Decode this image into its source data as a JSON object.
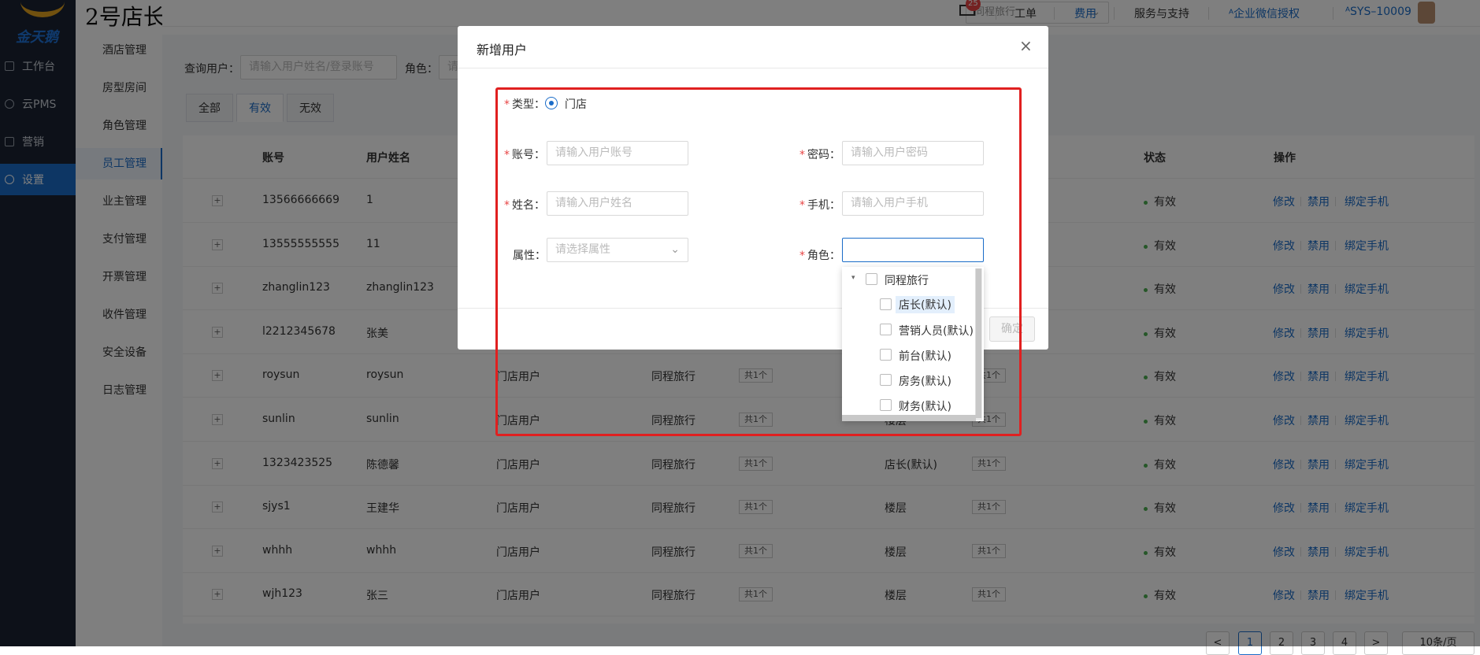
{
  "brand": {
    "logo_text": "金天鹅",
    "shop_title": "2号店长"
  },
  "rail": [
    {
      "label": "工作台",
      "icon": "grid-icon"
    },
    {
      "label": "云PMS",
      "icon": "settings-icon"
    },
    {
      "label": "营销",
      "icon": "grid-icon"
    },
    {
      "label": "设置",
      "icon": "gear-icon",
      "active": true
    }
  ],
  "submenu": [
    "酒店管理",
    "房型房间",
    "角色管理",
    "员工管理",
    "业主管理",
    "支付管理",
    "开票管理",
    "收件管理",
    "安全设备",
    "日志管理"
  ],
  "topbar": {
    "store_select": "同程旅行",
    "mail_badge": "25",
    "links": {
      "ticket": "工单",
      "fee": "费用",
      "service": "服务与支持",
      "wechat": "企业微信授权",
      "user": "SYS–10009"
    }
  },
  "search": {
    "query_label": "查询用户：",
    "query_placeholder": "请输入用户姓名/登录账号",
    "role_label": "角色：",
    "role_placeholder": "请"
  },
  "filter_tabs": [
    "全部",
    "有效",
    "无效"
  ],
  "table": {
    "headers": {
      "account": "账号",
      "name": "用户姓名",
      "status": "状态",
      "ops": "操作"
    },
    "rows": [
      {
        "account": "13566666669",
        "name": "1",
        "type": "",
        "store": "",
        "count1": "",
        "role": "",
        "count2": "",
        "status": "有效"
      },
      {
        "account": "13555555555",
        "name": "11",
        "type": "",
        "store": "",
        "count1": "",
        "role": "",
        "count2": "",
        "status": "有效"
      },
      {
        "account": "zhanglin123",
        "name": "zhanglin123",
        "type": "",
        "store": "",
        "count1": "",
        "role": "",
        "count2": "",
        "status": "有效"
      },
      {
        "account": "l2212345678",
        "name": "张美",
        "type": "",
        "store": "",
        "count1": "",
        "role": "",
        "count2": "",
        "status": "有效"
      },
      {
        "account": "roysun",
        "name": "roysun",
        "type": "门店用户",
        "store": "同程旅行",
        "count1": "共1个",
        "role": "",
        "count2": "共1个",
        "status": "有效"
      },
      {
        "account": "sunlin",
        "name": "sunlin",
        "type": "门店用户",
        "store": "同程旅行",
        "count1": "共1个",
        "role": "楼层",
        "count2": "共1个",
        "status": "有效"
      },
      {
        "account": "1323423525",
        "name": "陈德馨",
        "type": "门店用户",
        "store": "同程旅行",
        "count1": "共1个",
        "role": "店长(默认)",
        "count2": "共1个",
        "status": "有效"
      },
      {
        "account": "sjys1",
        "name": "王建华",
        "type": "门店用户",
        "store": "同程旅行",
        "count1": "共1个",
        "role": "楼层",
        "count2": "共1个",
        "status": "有效"
      },
      {
        "account": "whhh",
        "name": "whhh",
        "type": "门店用户",
        "store": "同程旅行",
        "count1": "共1个",
        "role": "楼层",
        "count2": "共1个",
        "status": "有效"
      },
      {
        "account": "wjh123",
        "name": "张三",
        "type": "门店用户",
        "store": "同程旅行",
        "count1": "共1个",
        "role": "楼层",
        "count2": "共1个",
        "status": "有效"
      }
    ],
    "ops": {
      "edit": "修改",
      "disable": "禁用",
      "bind": "绑定手机"
    },
    "expand_symbol": "+"
  },
  "pager": {
    "prev": "<",
    "pages": [
      "1",
      "2",
      "3",
      "4"
    ],
    "next": ">",
    "size": "10条/页"
  },
  "dialog": {
    "title": "新增用户",
    "close": "×",
    "type_label": "类型：",
    "type_value": "门店",
    "account_label": "账号：",
    "account_placeholder": "请输入用户账号",
    "password_label": "密码：",
    "password_placeholder": "请输入用户密码",
    "name_label": "姓名：",
    "name_placeholder": "请输入用户姓名",
    "phone_label": "手机：",
    "phone_placeholder": "请输入用户手机",
    "attr_label": "属性：",
    "attr_placeholder": "请选择属性",
    "role_label": "角色：",
    "confirm": "确定",
    "required_mark": "*"
  },
  "role_tree": {
    "parent": "同程旅行",
    "children": [
      "店长(默认)",
      "营销人员(默认)",
      "前台(默认)",
      "房务(默认)",
      "财务(默认)"
    ]
  },
  "colors": {
    "accent": "#1a6cc8",
    "highlight_box": "#e02020",
    "sidebar": "#1a2333",
    "status_ok": "#4caf50"
  }
}
